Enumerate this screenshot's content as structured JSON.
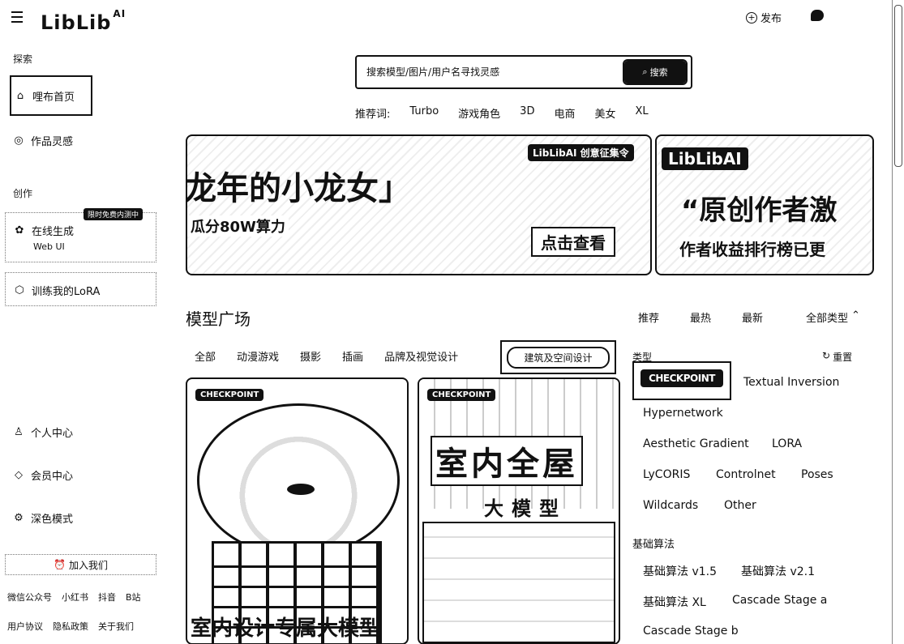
{
  "header": {
    "logo": "LibLib",
    "logo_sup": "AI",
    "publish_label": "发布"
  },
  "sidebar": {
    "explore_heading": "探索",
    "home_label": "哩布首页",
    "inspiration_label": "作品灵感",
    "create_heading": "创作",
    "online_label": "在线生成",
    "online_sub": "Web UI",
    "online_badge": "限时免费内测中",
    "train_label": "训练我的LoRA",
    "personal_label": "个人中心",
    "member_label": "会员中心",
    "darkmode_label": "深色模式",
    "join_label": "加入我们",
    "footer_row1": [
      "微信公众号",
      "小红书",
      "抖音",
      "B站"
    ],
    "footer_row2": [
      "用户协议",
      "隐私政策",
      "关于我们"
    ]
  },
  "search": {
    "placeholder": "搜索模型/图片/用户名寻找灵感",
    "button_label": "搜索",
    "recommend_label": "推荐词:",
    "recommend_words": [
      "Turbo",
      "游戏角色",
      "3D",
      "电商",
      "美女",
      "XL"
    ]
  },
  "banners": {
    "b1_title": "龙年的小龙女」",
    "b1_sub": "瓜分80W算力",
    "b1_logo": "LibLibAI 创意征集令",
    "b1_button": "点击查看",
    "b2_logo": "LibLibAI",
    "b2_title": "“原创作者激",
    "b2_sub": "作者收益排行榜已更"
  },
  "market": {
    "title": "模型广场",
    "sort_options": [
      "推荐",
      "最热",
      "最新"
    ],
    "all_types": "全部类型",
    "category_tabs": [
      "全部",
      "动漫游戏",
      "摄影",
      "插画",
      "品牌及视觉设计"
    ],
    "active_tab": "建筑及空间设计"
  },
  "cards": [
    {
      "tag": "CHECKPOINT",
      "caption": "室内设计专属大模型"
    },
    {
      "tag": "CHECKPOINT",
      "title": "室内全屋",
      "subtitle": "大模型"
    }
  ],
  "filters": {
    "type_heading": "类型",
    "reset_label": "重置",
    "types": [
      "CHECKPOINT",
      "Textual Inversion",
      "Hypernetwork",
      "Aesthetic Gradient",
      "LORA",
      "LyCORIS",
      "Controlnet",
      "Poses",
      "Wildcards",
      "Other"
    ],
    "base_heading": "基础算法",
    "base": [
      "基础算法 v1.5",
      "基础算法 v2.1",
      "基础算法 XL",
      "Cascade Stage a",
      "Cascade Stage b"
    ]
  }
}
